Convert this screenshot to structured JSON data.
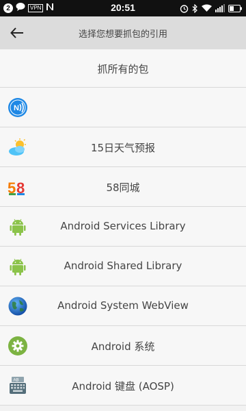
{
  "status_bar": {
    "notification_count": "2",
    "vpn": "VPN",
    "time": "20:51",
    "battery": "39"
  },
  "header": {
    "title": "选择您想要抓包的引用"
  },
  "list": {
    "all_label": "抓所有的包",
    "items": [
      {
        "label": "",
        "icon": "nfc-app-icon"
      },
      {
        "label": "15日天气预报",
        "icon": "weather-icon"
      },
      {
        "label": "58同城",
        "icon": "58-logo-icon"
      },
      {
        "label": "Android Services Library",
        "icon": "android-icon"
      },
      {
        "label": "Android Shared Library",
        "icon": "android-icon"
      },
      {
        "label": "Android System WebView",
        "icon": "globe-icon"
      },
      {
        "label": "Android 系统",
        "icon": "settings-gear-icon"
      },
      {
        "label": "Android 键盘 (AOSP)",
        "icon": "keyboard-icon"
      }
    ]
  },
  "colors": {
    "header_bg": "#dcdcdc",
    "android_green": "#8bc34a",
    "nfc_blue": "#1e88e5",
    "gear_green": "#7cb342"
  }
}
